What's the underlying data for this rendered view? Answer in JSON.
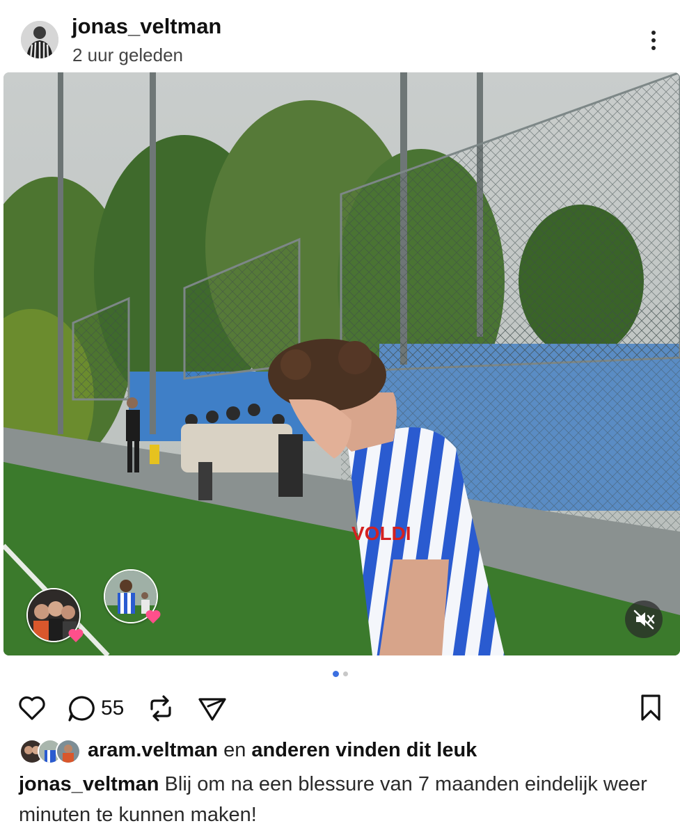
{
  "post": {
    "username": "jonas_veltman",
    "timestamp": "2 uur geleden",
    "comment_count": "55",
    "liked_by_user": "aram.veltman",
    "likes_joiner": "en",
    "likes_suffix": "anderen vinden dit leuk",
    "caption_user": "jonas_veltman",
    "caption_text": "Blij om na een blessure van 7 maanden eindelijk weer minuten te kunnen maken!"
  },
  "carousel": {
    "current": 1,
    "total": 2
  },
  "media": {
    "type": "photo",
    "muted": true,
    "shirt_sponsor": "VOLDI"
  },
  "icons": {
    "more": "more-vertical-icon",
    "like": "heart-outline-icon",
    "comment": "comment-bubble-icon",
    "repost": "repost-icon",
    "share": "paper-plane-icon",
    "save": "bookmark-outline-icon",
    "mute": "speaker-muted-icon"
  },
  "colors": {
    "accent_dot": "#3b6fe0",
    "inactive_dot": "#c8c8c8",
    "heart_badge": "#ff4f8b",
    "text": "#111111"
  }
}
